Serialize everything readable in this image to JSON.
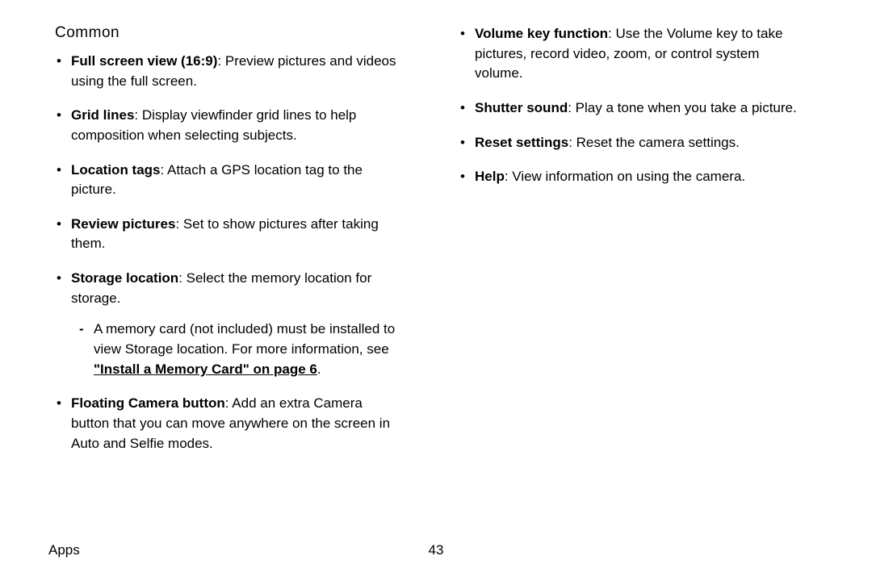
{
  "heading": "Common",
  "left": [
    {
      "term": "Full screen view (16:9)",
      "desc": ": Preview pictures and videos using the full screen."
    },
    {
      "term": "Grid lines",
      "desc": ": Display viewfinder grid lines to help composition when selecting subjects."
    },
    {
      "term": "Location tags",
      "desc": ": Attach a GPS location tag to the picture."
    },
    {
      "term": "Review pictures",
      "desc": ": Set to show pictures after taking them."
    },
    {
      "term": "Storage location",
      "desc": ": Select the memory location for storage.",
      "sub": {
        "pre": "A memory card (not included) must be installed to view Storage location. For more information, see ",
        "link": "\"Install a Memory Card\" on page 6",
        "post": "."
      }
    },
    {
      "term": "Floating Camera button",
      "desc": ": Add an extra Camera button that you can move anywhere on the screen in Auto and Selfie modes."
    }
  ],
  "right": [
    {
      "term": "Volume key function",
      "desc": ": Use the Volume key to take pictures, record video, zoom, or control system volume."
    },
    {
      "term": "Shutter sound",
      "desc": ": Play a tone when you take a picture."
    },
    {
      "term": "Reset settings",
      "desc": ": Reset the camera settings."
    },
    {
      "term": "Help",
      "desc": ": View information on using the camera."
    }
  ],
  "footer": {
    "section": "Apps",
    "page": "43"
  }
}
